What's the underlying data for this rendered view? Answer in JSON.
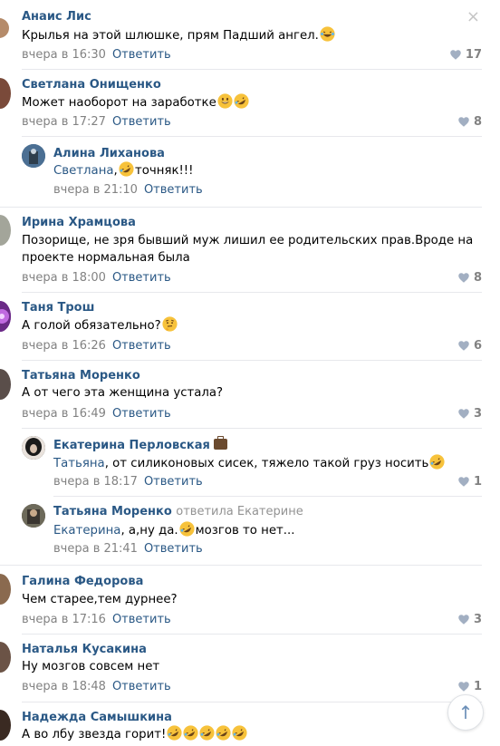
{
  "close_icon": "×",
  "reply_label": "Ответить",
  "comments": [
    {
      "name": "Анаис Лис",
      "text": "Крылья на этой шлюшке, прям Падший ангел.",
      "emoji": [
        "laugh-tears-emoji"
      ],
      "time": "вчера в 16:30",
      "likes": "17",
      "avatar_color": "#b58b6a"
    },
    {
      "name": "Светлана Онищенко",
      "text": "Может наоборот на заработке",
      "emoji": [
        "grin-emoji",
        "rofl-emoji"
      ],
      "time": "вчера в 17:27",
      "likes": "8",
      "avatar_color": "#7a4a3a"
    },
    {
      "name": "Алина Лиханова",
      "mention": "Светлана",
      "text": ", ",
      "text2": "точняк!!!",
      "emoji": [
        "rofl-emoji"
      ],
      "time": "вчера в 21:10",
      "likes": "",
      "avatar_color": "#4b6f93"
    },
    {
      "name": "Ирина Храмцова",
      "text": "Позорище, не зря бывший муж лишил ее родительских прав.Вроде на",
      "text_line2": "проекте нормальная была",
      "time": "вчера в 18:00",
      "likes": "8",
      "avatar_color": "#a3a59a"
    },
    {
      "name": "Таня Трош",
      "text": "А голой обязательно?",
      "emoji": [
        "thinking-emoji"
      ],
      "time": "вчера в 16:26",
      "likes": "6",
      "avatar_color": "#8a3fa8"
    },
    {
      "name": "Татьяна Моренко",
      "text": "А от чего эта женщина устала?",
      "time": "вчера в 16:49",
      "likes": "3",
      "avatar_color": "#5a4e4a"
    },
    {
      "name": "Екатерина Перловская",
      "mention": "Татьяна",
      "text": ", от силиконовых сисек, тяжело такой груз носить",
      "emoji": [
        "rofl-emoji"
      ],
      "time": "вчера в 18:17",
      "likes": "1",
      "avatar_color": "#1a1a1a"
    },
    {
      "name": "Татьяна Моренко",
      "reply_to": "ответила Екатерине",
      "mention": "Екатерина",
      "text": ", а,ну да.",
      "text2": "мозгов то нет...",
      "emoji": [
        "rofl-emoji"
      ],
      "time": "вчера в 21:41",
      "likes": "",
      "avatar_color": "#5a4e4a"
    },
    {
      "name": "Галина Федорова",
      "text": "Чем старее,тем дурнее?",
      "time": "вчера в 17:16",
      "likes": "3",
      "avatar_color": "#8a6a4f"
    },
    {
      "name": "Наталья Кусакина",
      "text": "Ну мозгов совсем нет",
      "time": "вчера в 18:48",
      "likes": "1",
      "avatar_color": "#6b5346"
    },
    {
      "name": "Надежда Самышкина",
      "text": "А во лбу звезда горит!",
      "emoji": [
        "rofl-emoji",
        "rofl-emoji",
        "rofl-emoji",
        "rofl-emoji",
        "rofl-emoji"
      ],
      "avatar_color": "#3a2a22"
    }
  ],
  "scroll_up_icon": "↑",
  "colors": {
    "link": "#2a5885",
    "meta": "#828282",
    "divider": "#e7e8ec"
  }
}
